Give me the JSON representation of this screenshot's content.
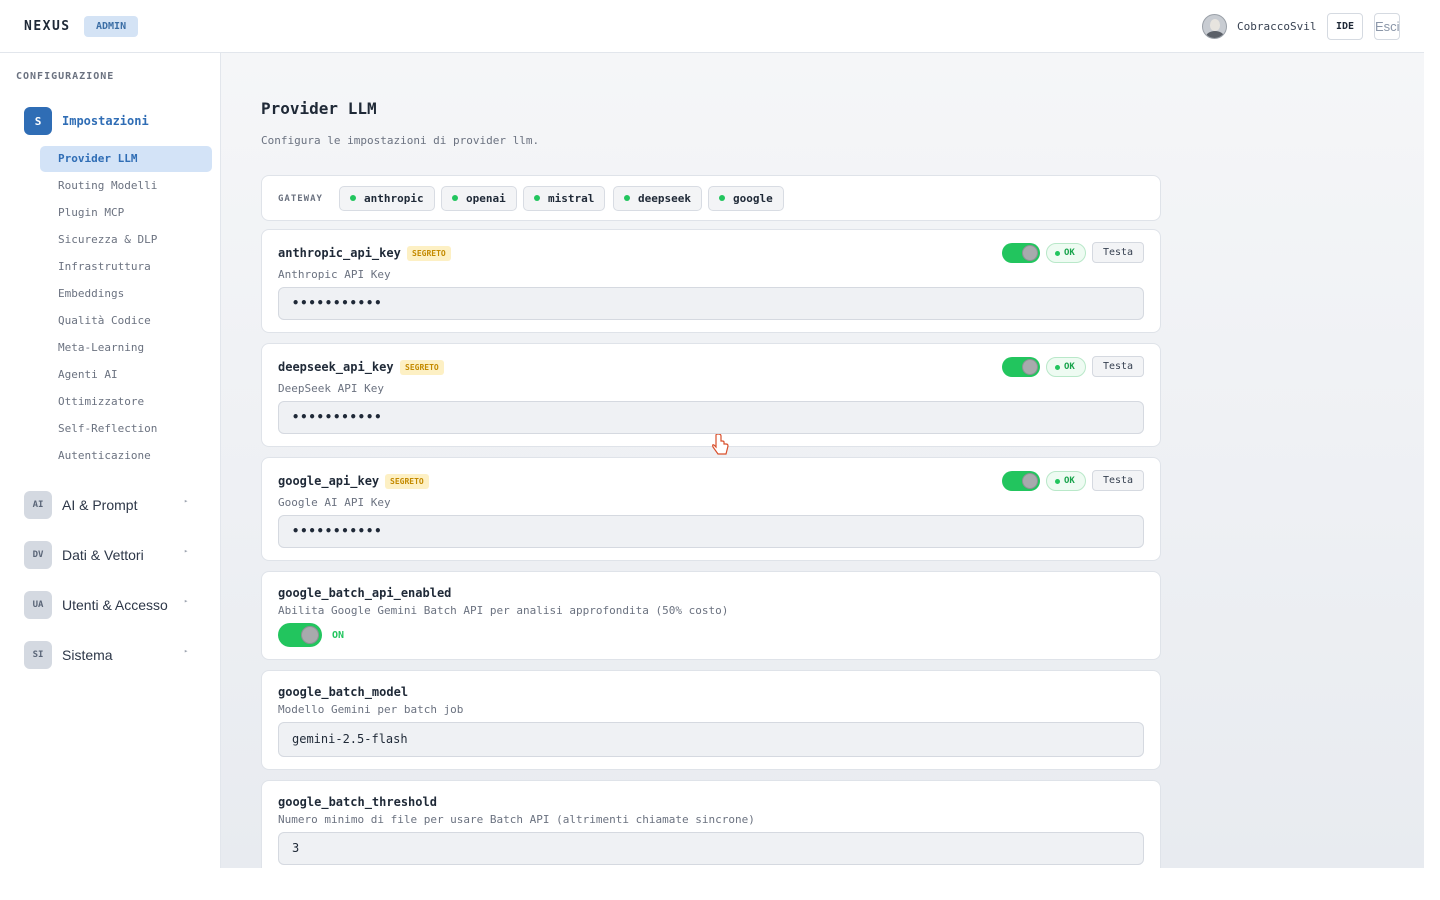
{
  "header": {
    "brand": "NEXUS",
    "role_badge": "ADMIN",
    "username": "CobraccoSvil",
    "ide_label": "IDE",
    "exit_label": "Esci"
  },
  "sidebar": {
    "section_label": "CONFIGURAZIONE",
    "active_group": {
      "icon": "S",
      "title": "Impostazioni"
    },
    "items": [
      {
        "label": "Provider LLM",
        "active": true
      },
      {
        "label": "Routing Modelli"
      },
      {
        "label": "Plugin MCP"
      },
      {
        "label": "Sicurezza & DLP"
      },
      {
        "label": "Infrastruttura"
      },
      {
        "label": "Embeddings"
      },
      {
        "label": "Qualità Codice"
      },
      {
        "label": "Meta-Learning"
      },
      {
        "label": "Agenti AI"
      },
      {
        "label": "Ottimizzatore"
      },
      {
        "label": "Self-Reflection"
      },
      {
        "label": "Autenticazione"
      }
    ],
    "groups": [
      {
        "icon": "AI",
        "title": "AI & Prompt",
        "chevron": "▸"
      },
      {
        "icon": "DV",
        "title": "Dati & Vettori",
        "chevron": "▸"
      },
      {
        "icon": "UA",
        "title": "Utenti & Accesso",
        "chevron": "▸"
      },
      {
        "icon": "SI",
        "title": "Sistema",
        "chevron": "▸"
      }
    ]
  },
  "main": {
    "title": "Provider LLM",
    "subtitle": "Configura le impostazioni di provider llm.",
    "gateway": {
      "label": "GATEWAY",
      "providers": [
        "anthropic",
        "openai",
        "mistral",
        "deepseek",
        "google"
      ]
    },
    "secret_badge": "SEGRETO",
    "status_ok": "OK",
    "test_label": "Testa",
    "settings": [
      {
        "key": "anthropic_api_key",
        "description": "Anthropic API Key",
        "value": "•••••••••••",
        "secret": true,
        "enabled": true
      },
      {
        "key": "deepseek_api_key",
        "description": "DeepSeek API Key",
        "value": "•••••••••••",
        "secret": true,
        "enabled": true
      },
      {
        "key": "google_api_key",
        "description": "Google AI API Key",
        "value": "•••••••••••",
        "secret": true,
        "enabled": true
      },
      {
        "key": "google_batch_api_enabled",
        "description": "Abilita Google Gemini Batch API per analisi approfondita (50% costo)",
        "toggle_state": "ON",
        "enabled": true
      },
      {
        "key": "google_batch_model",
        "description": "Modello Gemini per batch job",
        "value": "gemini-2.5-flash"
      },
      {
        "key": "google_batch_threshold",
        "description": "Numero minimo di file per usare Batch API (altrimenti chiamate sincrone)",
        "value": "3"
      }
    ]
  },
  "colors": {
    "accent": "#2f6db5",
    "success": "#22c55e",
    "secret": "#c48a00"
  }
}
